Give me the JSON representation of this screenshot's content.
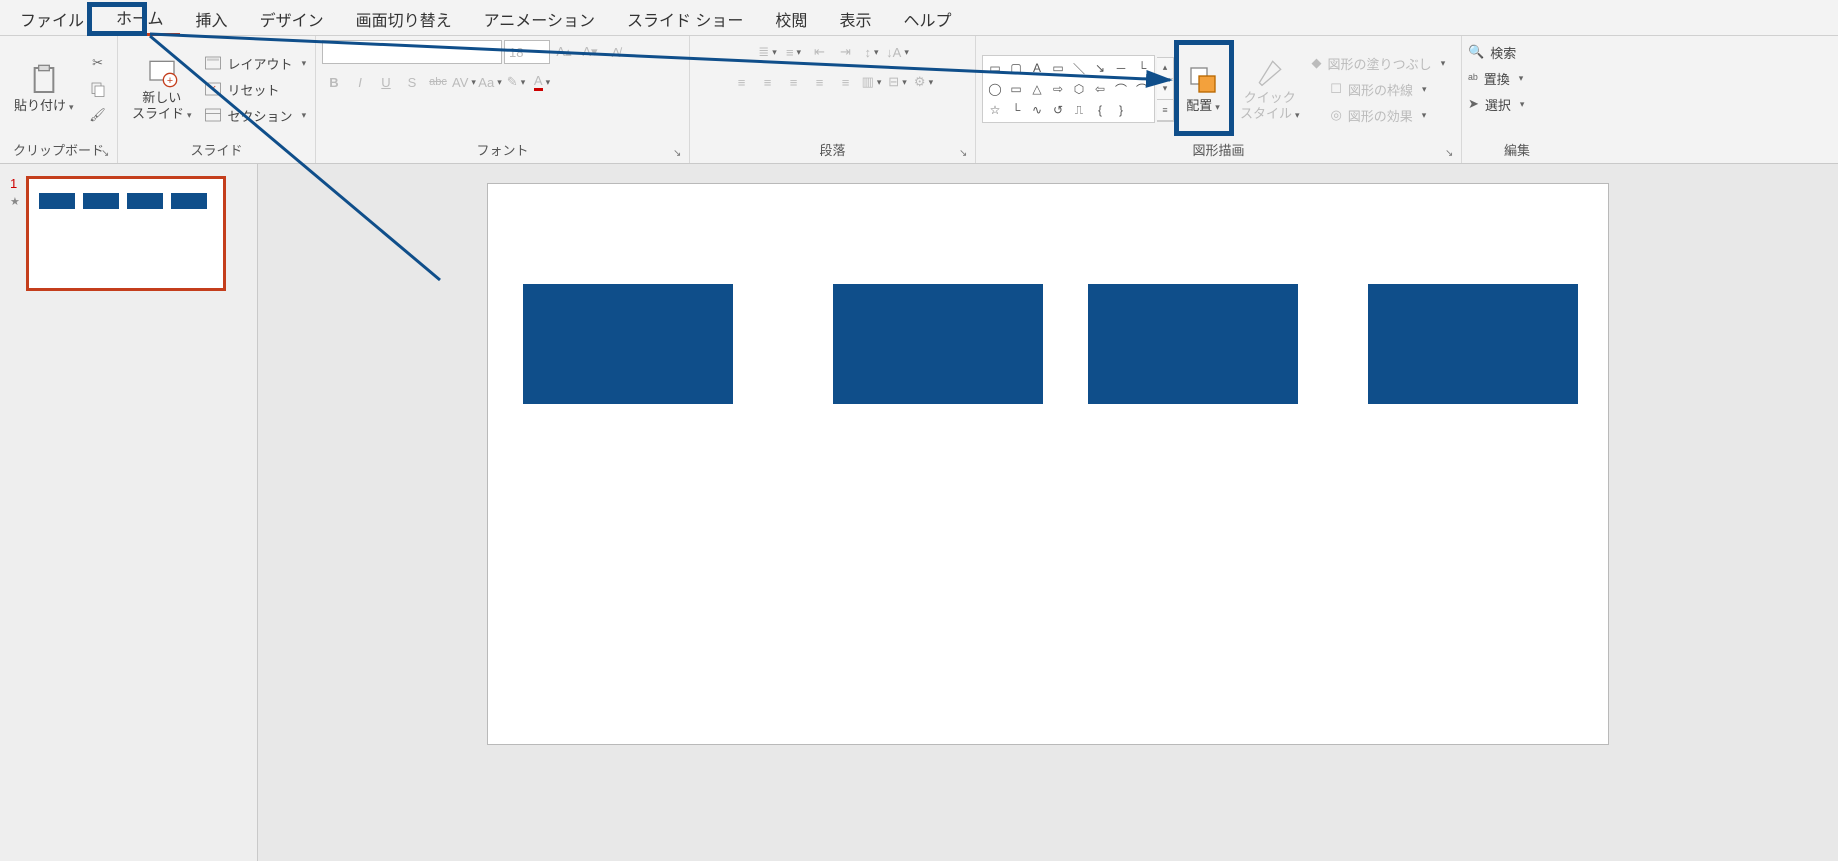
{
  "tabs": [
    "ファイル",
    "ホーム",
    "挿入",
    "デザイン",
    "画面切り替え",
    "アニメーション",
    "スライド ショー",
    "校閲",
    "表示",
    "ヘルプ"
  ],
  "active_tab_index": 1,
  "groups": {
    "clipboard": {
      "label": "クリップボード",
      "paste": "貼り付け"
    },
    "slides": {
      "label": "スライド",
      "new_slide": "新しい\nスライド",
      "layout": "レイアウト",
      "reset": "リセット",
      "section": "セクション"
    },
    "font": {
      "label": "フォント",
      "size_placeholder": "18",
      "bold": "B",
      "italic": "I",
      "underline": "U",
      "shadow": "S",
      "strike": "abc",
      "spacing": "AV",
      "case": "Aa"
    },
    "paragraph": {
      "label": "段落"
    },
    "drawing": {
      "label": "図形描画",
      "arrange": "配置",
      "quick_style": "クイック\nスタイル",
      "fill": "図形の塗りつぶし",
      "outline": "図形の枠線",
      "effects": "図形の効果"
    },
    "editing": {
      "label": "編集",
      "find": "検索",
      "replace": "置換",
      "select": "選択"
    }
  },
  "thumbnail": {
    "number": "1",
    "star": "★"
  },
  "colors": {
    "shape_fill": "#0f4e8a",
    "tab_underline": "#c43e1c",
    "highlight": "#0f4e8a"
  }
}
